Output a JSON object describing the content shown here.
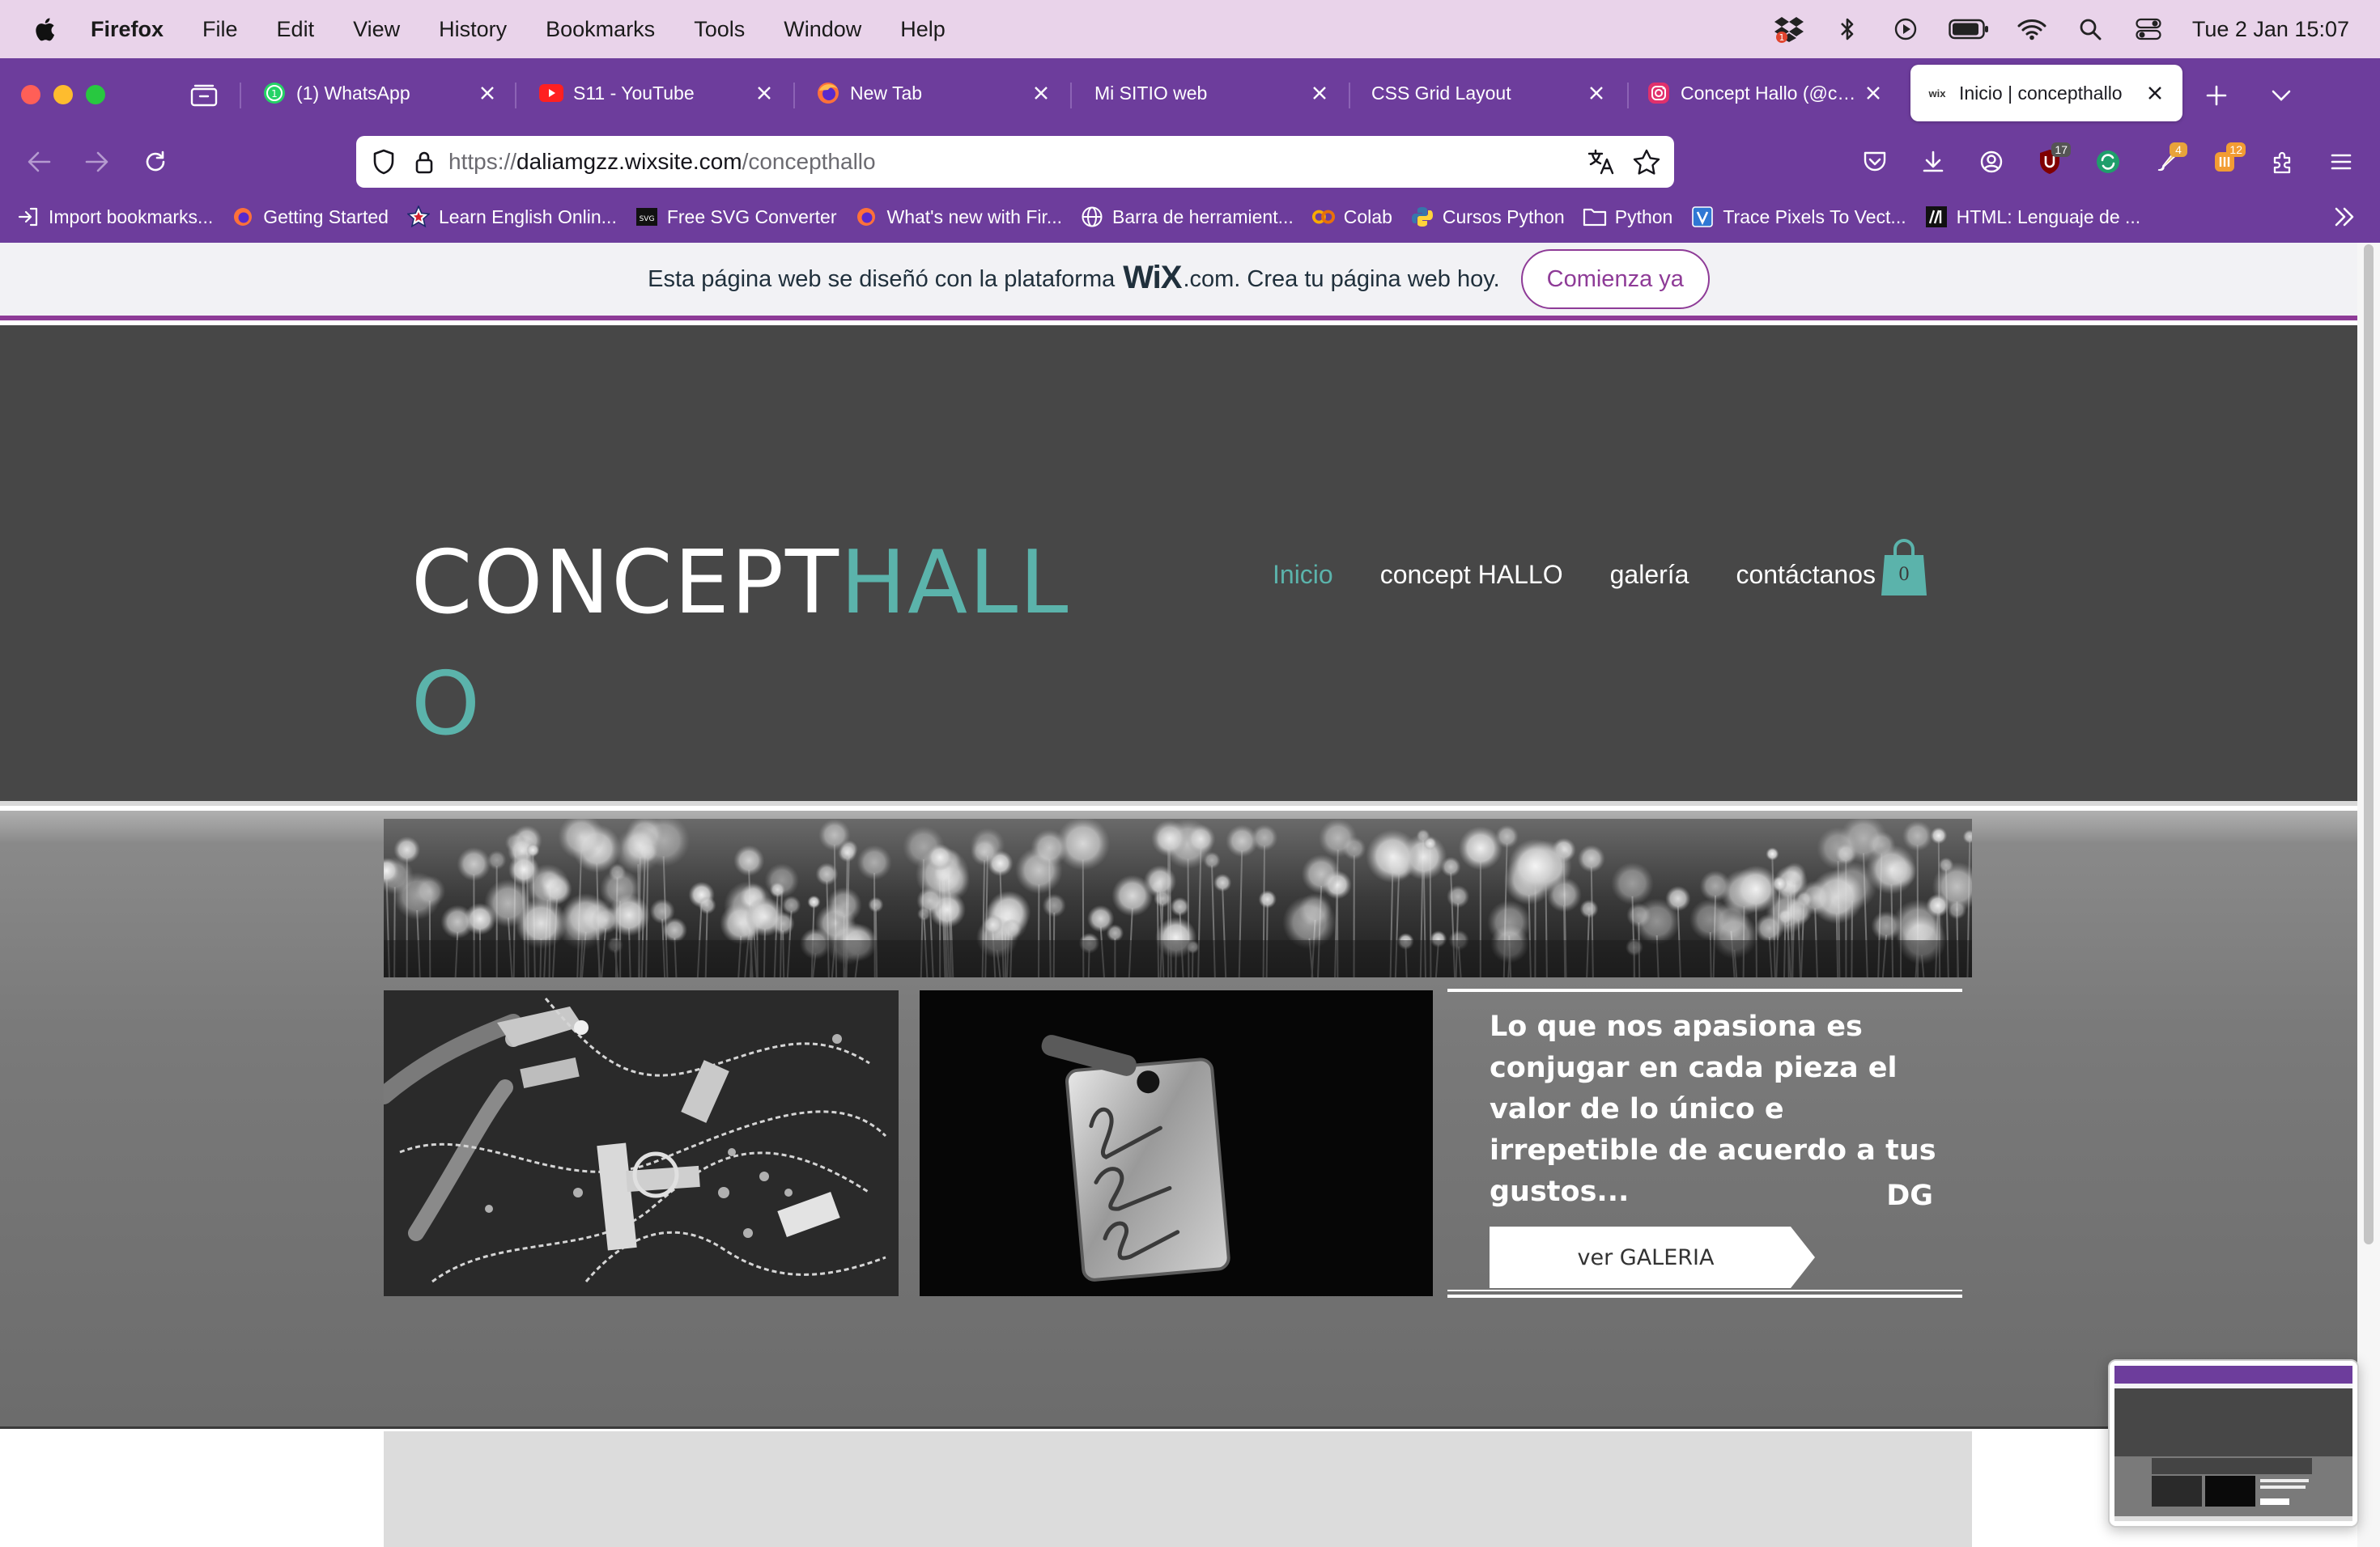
{
  "menubar": {
    "app_name": "Firefox",
    "items": [
      "File",
      "Edit",
      "View",
      "History",
      "Bookmarks",
      "Tools",
      "Window",
      "Help"
    ],
    "clock": "Tue 2 Jan  15:07"
  },
  "browser": {
    "tabs": [
      {
        "label": "(1) WhatsApp",
        "icon": "whatsapp-icon"
      },
      {
        "label": "S11 - YouTube",
        "icon": "youtube-icon"
      },
      {
        "label": "New Tab",
        "icon": "firefox-icon"
      },
      {
        "label": "Mi SITIO web",
        "icon": ""
      },
      {
        "label": "CSS Grid Layout",
        "icon": ""
      },
      {
        "label": "Concept Hallo (@conc",
        "icon": "instagram-icon"
      },
      {
        "label": "Inicio | concepthallo",
        "icon": "wix-icon"
      }
    ],
    "active_tab_favicon_text": "wix",
    "url_prefix": "https://",
    "url_host": "daliamgzz.wixsite.com",
    "url_path": "/concepthallo",
    "badges": {
      "ublock": "17",
      "ext_a": "4",
      "ext_b": "12"
    },
    "bookmarks": [
      "Import bookmarks...",
      "Getting Started",
      "Learn English Onlin...",
      "Free SVG Converter",
      "What's new with Fir...",
      "Barra de herramient...",
      "Colab",
      "Cursos Python",
      "Python",
      "Trace Pixels To Vect...",
      "HTML: Lenguaje de ..."
    ]
  },
  "wix_banner": {
    "text_before": "Esta página web se diseñó con la plataforma",
    "logo": "WiX",
    "text_after": ".com. Crea tu página web hoy.",
    "cta": "Comienza ya"
  },
  "site": {
    "logo_part1": "CONCEPT",
    "logo_part2": "HALL",
    "logo_part3": "O",
    "nav": [
      "Inicio",
      "concept HALLO",
      "galería",
      "contáctanos"
    ],
    "cart_count": "0",
    "quote": "Lo que nos apasiona es conjugar en cada pieza el valor de lo único e irrepetible de acuerdo a tus gustos...",
    "quote_signature": "DG",
    "gallery_button": "ver GALERIA"
  },
  "colors": {
    "menubar_bg": "#e9d3ea",
    "chrome_bg": "#6d3d9c",
    "site_header_bg": "#474747",
    "accent_teal": "#5bb3ab",
    "wix_purple": "#8e3b97"
  }
}
